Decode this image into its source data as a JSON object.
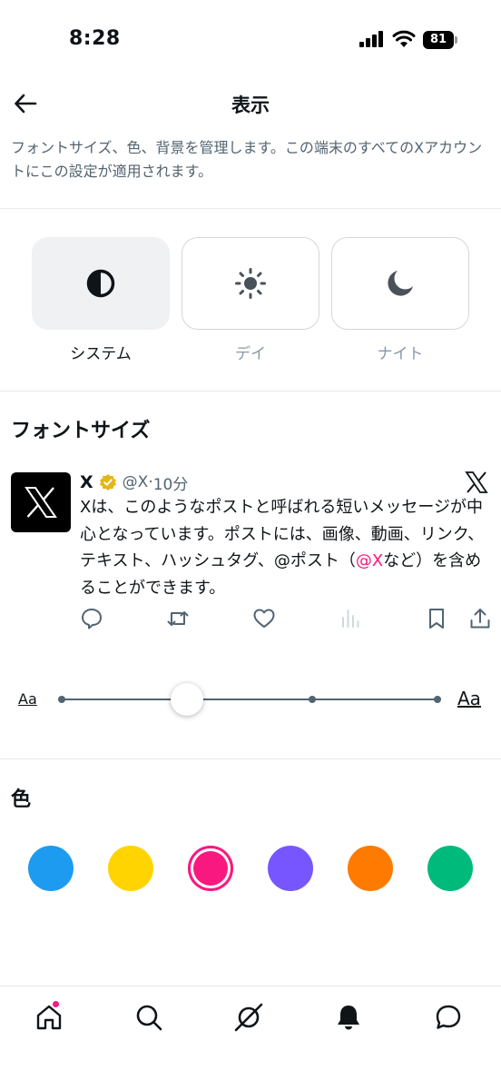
{
  "status_bar": {
    "time": "8:28",
    "battery": "81"
  },
  "header": {
    "title": "表示"
  },
  "description": "フォントサイズ、色、背景を管理します。この端末のすべてのXアカウントにこの設定が適用されます。",
  "theme": {
    "options": [
      {
        "label": "システム",
        "icon": "contrast-icon",
        "selected": true
      },
      {
        "label": "デイ",
        "icon": "sun-icon",
        "selected": false
      },
      {
        "label": "ナイト",
        "icon": "moon-icon",
        "selected": false
      }
    ]
  },
  "font_size": {
    "title": "フォントサイズ",
    "small_label": "Aa",
    "large_label": "Aa",
    "steps": 4,
    "selected_step": 1
  },
  "sample_post": {
    "name": "X",
    "handle": "@X",
    "separator": "·",
    "time": "10分",
    "text_before": "Xは、このようなポストと呼ばれる短いメッセージが中心となっています。ポストには、画像、動画、リンク、テキスト、ハッシュタグ、@ポスト（",
    "mention": "@X",
    "text_after": "など）を含めることができます。"
  },
  "color": {
    "title": "色",
    "swatches": [
      {
        "name": "blue",
        "hex": "#1d9bf0",
        "selected": false
      },
      {
        "name": "yellow",
        "hex": "#ffd400",
        "selected": false
      },
      {
        "name": "pink",
        "hex": "#f91880",
        "selected": true
      },
      {
        "name": "purple",
        "hex": "#7856ff",
        "selected": false
      },
      {
        "name": "orange",
        "hex": "#ff7a00",
        "selected": false
      },
      {
        "name": "green",
        "hex": "#00ba7c",
        "selected": false
      }
    ]
  },
  "tab_bar": {
    "items": [
      "home-icon",
      "search-icon",
      "grok-icon",
      "notifications-icon",
      "messages-icon"
    ]
  }
}
